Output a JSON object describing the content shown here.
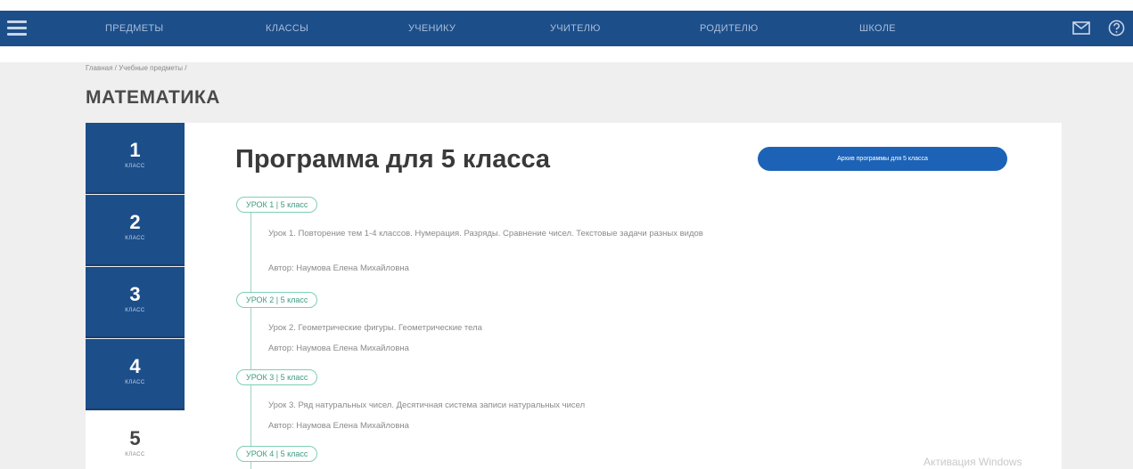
{
  "nav": {
    "items": [
      "ПРЕДМЕТЫ",
      "КЛАССЫ",
      "УЧЕНИКУ",
      "УЧИТЕЛЮ",
      "РОДИТЕЛЮ",
      "ШКОЛЕ"
    ],
    "menu_icon": "hamburger-icon",
    "mail_icon": "mail-icon",
    "help_icon": "help-icon",
    "bar_color": "#1c4e8a"
  },
  "breadcrumb": [
    "Главная",
    "Учебные предметы"
  ],
  "page_title": "МАТЕМАТИКА",
  "grades": [
    {
      "num": "1",
      "label": "КЛАСС"
    },
    {
      "num": "2",
      "label": "КЛАСС"
    },
    {
      "num": "3",
      "label": "КЛАСС"
    },
    {
      "num": "4",
      "label": "КЛАСС"
    },
    {
      "num": "5",
      "label": "КЛАСС"
    }
  ],
  "program": {
    "title": "Программа для 5 класса",
    "archive_button": "Архив программы для 5 класса",
    "lessons": [
      {
        "tag": "УРОК 1 | 5 класс",
        "text": "Урок 1. Повторение тем 1-4 классов. Нумерация. Разряды. Сравнение чисел. Текстовые задачи разных видов",
        "author": "Автор: Наумова Елена Михайловна"
      },
      {
        "tag": "УРОК 2 | 5 класс",
        "text": "Урок 2. Геометрические фигуры. Геометрические тела",
        "author": "Автор: Наумова Елена Михайловна"
      },
      {
        "tag": "УРОК 3 | 5 класс",
        "text": "Урок 3. Ряд натуральных чисел. Десятичная система записи натуральных чисел",
        "author": "Автор: Наумова Елена Михайловна"
      },
      {
        "tag": "УРОК 4 | 5 класс"
      }
    ]
  },
  "watermark": "Активация Windows"
}
